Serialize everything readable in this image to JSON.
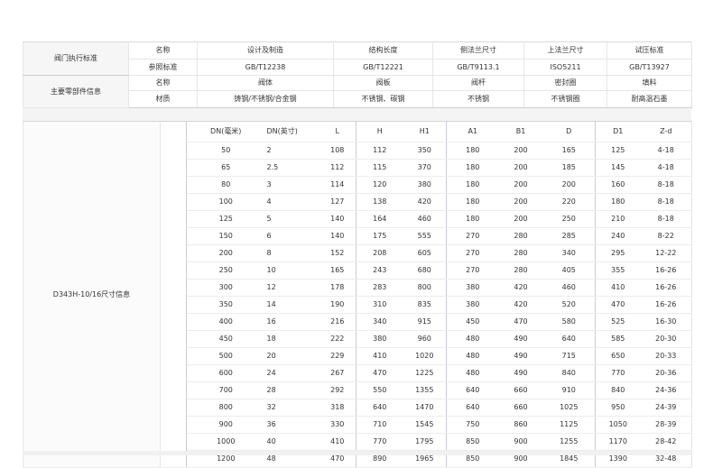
{
  "spec": {
    "row1": {
      "group": "阀门执行标准",
      "label": "名称",
      "cells": [
        "设计及制造",
        "结构长度",
        "侧法兰尺寸",
        "上法兰尺寸",
        "试压标准"
      ]
    },
    "row2": {
      "label": "参照标准",
      "cells": [
        "GB/T12238",
        "GB/T12221",
        "GB/T9113.1",
        "ISO5211",
        "GB/T13927"
      ]
    },
    "row3": {
      "group": "主要零部件信息",
      "label": "名称",
      "cells": [
        "阀体",
        "阀板",
        "阀杆",
        "密封圈",
        "填料"
      ]
    },
    "row4": {
      "label": "材质",
      "cells": [
        "铸钢/不锈钢/合金钢",
        "不锈钢、碳钢",
        "不锈钢",
        "不锈钢圈",
        "耐高温石墨"
      ]
    }
  },
  "dimensions": {
    "model_label": "D343H-10/16尺寸信息",
    "headers": [
      "DN(毫米)",
      "DN(英寸)",
      "L",
      "H",
      "H1",
      "A1",
      "B1",
      "D",
      "D1",
      "Z-d"
    ],
    "rows": [
      [
        "50",
        "2",
        "108",
        "112",
        "350",
        "180",
        "200",
        "165",
        "125",
        "4-18"
      ],
      [
        "65",
        "2.5",
        "112",
        "115",
        "370",
        "180",
        "200",
        "185",
        "145",
        "4-18"
      ],
      [
        "80",
        "3",
        "114",
        "120",
        "380",
        "180",
        "200",
        "200",
        "160",
        "8-18"
      ],
      [
        "100",
        "4",
        "127",
        "138",
        "420",
        "180",
        "200",
        "220",
        "180",
        "8-18"
      ],
      [
        "125",
        "5",
        "140",
        "164",
        "460",
        "180",
        "200",
        "250",
        "210",
        "8-18"
      ],
      [
        "150",
        "6",
        "140",
        "175",
        "555",
        "270",
        "280",
        "285",
        "240",
        "8-22"
      ],
      [
        "200",
        "8",
        "152",
        "208",
        "605",
        "270",
        "280",
        "340",
        "295",
        "12-22"
      ],
      [
        "250",
        "10",
        "165",
        "243",
        "680",
        "270",
        "280",
        "405",
        "355",
        "16-26"
      ],
      [
        "300",
        "12",
        "178",
        "283",
        "800",
        "380",
        "420",
        "460",
        "410",
        "16-26"
      ],
      [
        "350",
        "14",
        "190",
        "310",
        "835",
        "380",
        "420",
        "520",
        "470",
        "16-26"
      ],
      [
        "400",
        "16",
        "216",
        "340",
        "915",
        "450",
        "470",
        "580",
        "525",
        "16-30"
      ],
      [
        "450",
        "18",
        "222",
        "380",
        "960",
        "480",
        "490",
        "640",
        "585",
        "20-30"
      ],
      [
        "500",
        "20",
        "229",
        "410",
        "1020",
        "480",
        "490",
        "715",
        "650",
        "20-33"
      ],
      [
        "600",
        "24",
        "267",
        "470",
        "1225",
        "480",
        "490",
        "840",
        "770",
        "20-36"
      ],
      [
        "700",
        "28",
        "292",
        "550",
        "1355",
        "640",
        "660",
        "910",
        "840",
        "24-36"
      ],
      [
        "800",
        "32",
        "318",
        "640",
        "1470",
        "640",
        "660",
        "1025",
        "950",
        "24-39"
      ],
      [
        "900",
        "36",
        "330",
        "710",
        "1545",
        "750",
        "860",
        "1125",
        "1050",
        "28-39"
      ],
      [
        "1000",
        "40",
        "410",
        "770",
        "1795",
        "850",
        "900",
        "1255",
        "1170",
        "28-42"
      ],
      [
        "1200",
        "48",
        "470",
        "890",
        "1965",
        "850",
        "900",
        "1845",
        "1390",
        "32-48"
      ]
    ]
  }
}
